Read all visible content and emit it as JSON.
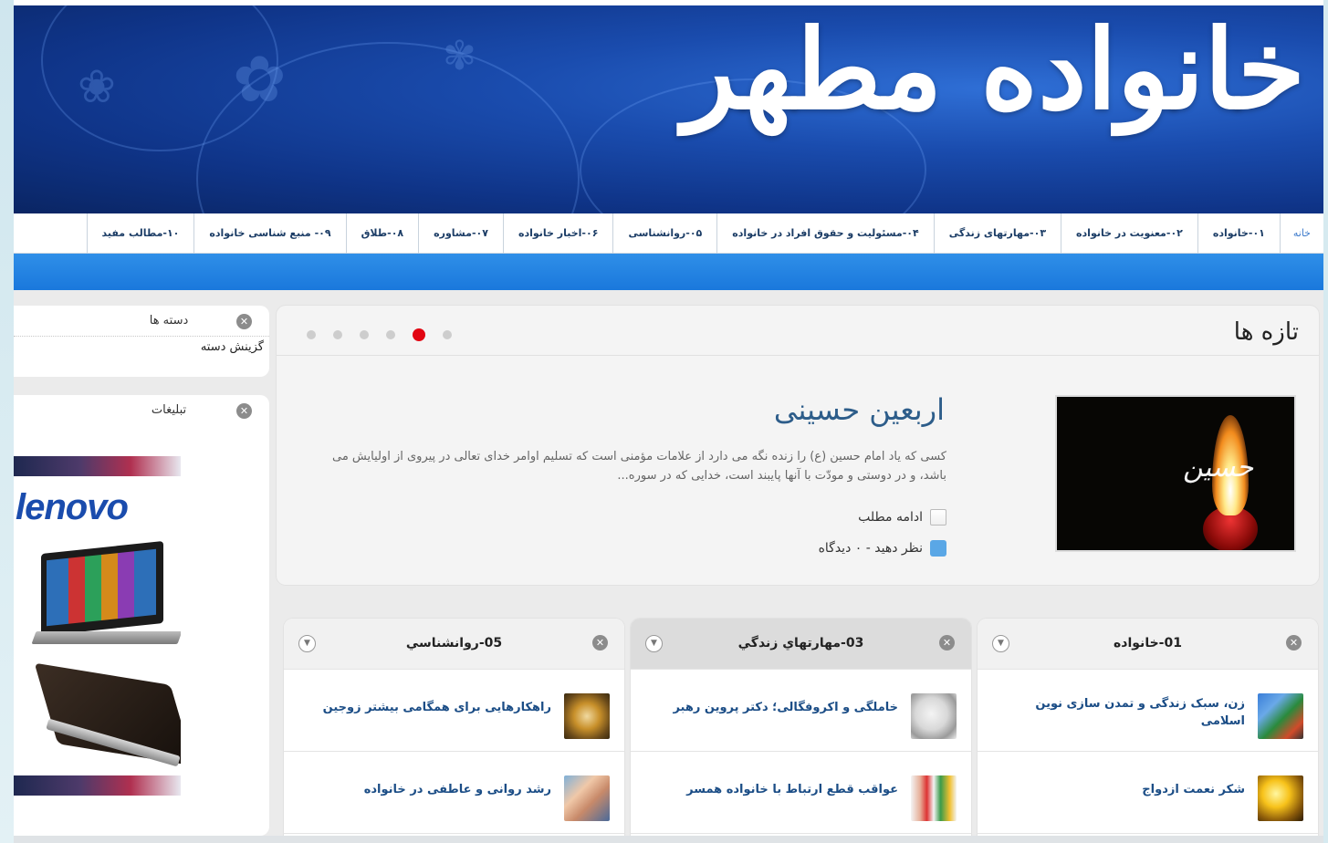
{
  "header": {
    "brand": "خانواده مطهر"
  },
  "nav": {
    "items": [
      {
        "label": "خانه"
      },
      {
        "label": "۰۱-خانواده"
      },
      {
        "label": "۰۲-معنویت در خانواده"
      },
      {
        "label": "۰۳-مهارتهای زندگی"
      },
      {
        "label": "۰۴-مسئولیت و حقوق افراد در خانواده"
      },
      {
        "label": "۰۵-روانشناسی"
      },
      {
        "label": "۰۶-اخبار خانواده"
      },
      {
        "label": "۰۷-مشاوره"
      },
      {
        "label": "۰۸-طلاق"
      },
      {
        "label": "۰۹- منبع شناسی خانواده"
      },
      {
        "label": "۱۰-مطالب مفید"
      }
    ]
  },
  "sidebar": {
    "categories": {
      "title": "دسته ها",
      "select_value": "گزینش دسته"
    },
    "ads": {
      "title": "تبلیغات",
      "ad_brand": "lenovo"
    }
  },
  "featured": {
    "title": "تازه ها",
    "slider_dot_count": 6,
    "active_dot_index": 4,
    "article": {
      "title": "اربعین حسینی",
      "excerpt": "کسی که یاد امام حسین (ع) را زنده نگه می دارد از علامات مؤمنی است که تسلیم اوامر خدای تعالی در پیروی از اولیایش می باشد، و در دوستی و مودّت با آنها پایبند است، خدایی که در سوره...",
      "read_more": "ادامه مطلب",
      "comments": "نظر دهید - ۰ دیدگاه",
      "image_calligraphy": "حسین"
    }
  },
  "categories": [
    {
      "title": "01-خانواده",
      "items": [
        {
          "label": "زن، سبک زندگی و تمدن سازی نوین اسلامی"
        },
        {
          "label": "شکر نعمت ازدواج"
        }
      ]
    },
    {
      "title": "03-مهارتهاي زندگي",
      "items": [
        {
          "label": "خاملگی و اکروفگالی؛ دکتر پروین رهبر"
        },
        {
          "label": "عواقب قطع ارتباط با خانواده همسر"
        }
      ]
    },
    {
      "title": "05-روانشناسي",
      "items": [
        {
          "label": "راهکارهایی برای همگامی بیشتر زوجین"
        },
        {
          "label": "رشد روانی و عاطفی در خانواده"
        }
      ]
    }
  ],
  "colors": {
    "header_blue": "#1a4cae",
    "nav_band": "#1a78dc",
    "link": "#1b4d86",
    "active_dot": "#e20612"
  }
}
